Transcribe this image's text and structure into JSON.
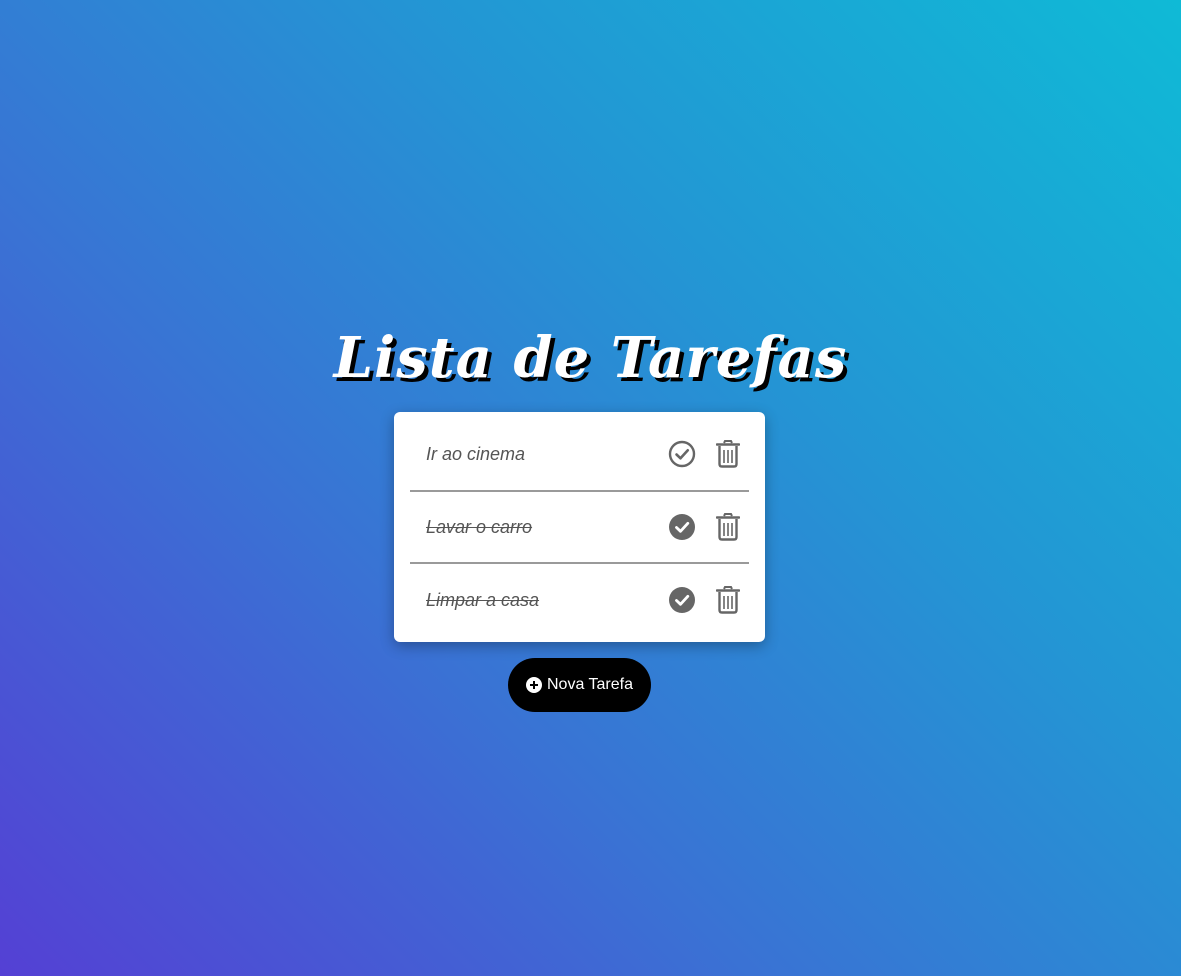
{
  "title": "Lista de Tarefas",
  "tasks": [
    {
      "text": "Ir ao cinema",
      "done": false
    },
    {
      "text": "Lavar o carro",
      "done": true
    },
    {
      "text": "Limpar a casa",
      "done": true
    }
  ],
  "add_button": {
    "label": "Nova Tarefa",
    "icon": "plus-circle-icon"
  },
  "icons": {
    "complete": "check-circle-icon",
    "delete": "trash-icon"
  },
  "colors": {
    "gradient_start": "#5440d4",
    "gradient_end": "#0fbad6",
    "icon": "#666666",
    "text": "#555555"
  }
}
